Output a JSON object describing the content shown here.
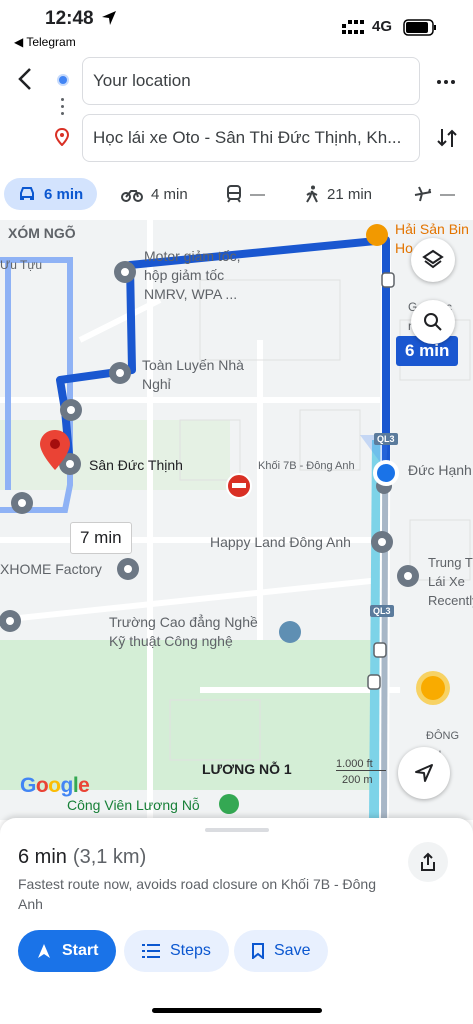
{
  "status": {
    "time": "12:48",
    "back_app": "◀ Telegram",
    "network": "4G"
  },
  "search": {
    "origin": "Your location",
    "destination": "Học lái xe Oto - Sân Thi Đức Thịnh, Kh..."
  },
  "modes": [
    {
      "name": "car",
      "label": "6 min",
      "active": true
    },
    {
      "name": "motorbike",
      "label": "4 min"
    },
    {
      "name": "transit",
      "label": "—"
    },
    {
      "name": "walk",
      "label": "21 min"
    },
    {
      "name": "flight",
      "label": "—"
    }
  ],
  "map": {
    "labels": {
      "xom_ngo": "XÓM NGÕ",
      "uu_tuu": "Ưu Tựu",
      "motor": "Motor giảm tốc,\nhộp giảm tốc\nNMRV, WPA ...",
      "hai_san": "Hải Sản Bin\nHo ... nh",
      "nha_nghi": "Toàn Luyến Nhà\nNghỉ",
      "san_duc_thinh": "Sân Đức Thịnh",
      "khoi_7b": "Khối 7B - Đông Anh",
      "duc_hanh": "Đức Hạnh",
      "happy_land": "Happy Land Đông Anh",
      "xhome": "XHOME Factory",
      "trung": "Trung T\nLái Xe\nRecently",
      "truong": "Trường Cao đẳng Nghề\nKỹ thuật Công nghệ",
      "luong_no": "LƯƠNG NỖ 1",
      "cong_vien": "Công Viên Lương Nỗ",
      "dong_anh": "ĐÔNG AN",
      "ql3": "QL3",
      "gtruc": "G... trực\nm ... xu"
    },
    "route_badge": "6 min",
    "alt_route_badge": "7 min",
    "scale": {
      "ft": "1.000 ft",
      "m": "200 m"
    },
    "logo": "Google",
    "colors": {
      "route": "#1a57d0",
      "alt_route": "#8fb2f5",
      "water": "#7dd3e8",
      "park": "#c8ebc9"
    }
  },
  "sheet": {
    "eta": "6 min",
    "distance": "(3,1 km)",
    "description": "Fastest route now, avoids road closure on Khối 7B - Đông Anh",
    "buttons": {
      "start": "Start",
      "steps": "Steps",
      "save": "Save"
    }
  }
}
